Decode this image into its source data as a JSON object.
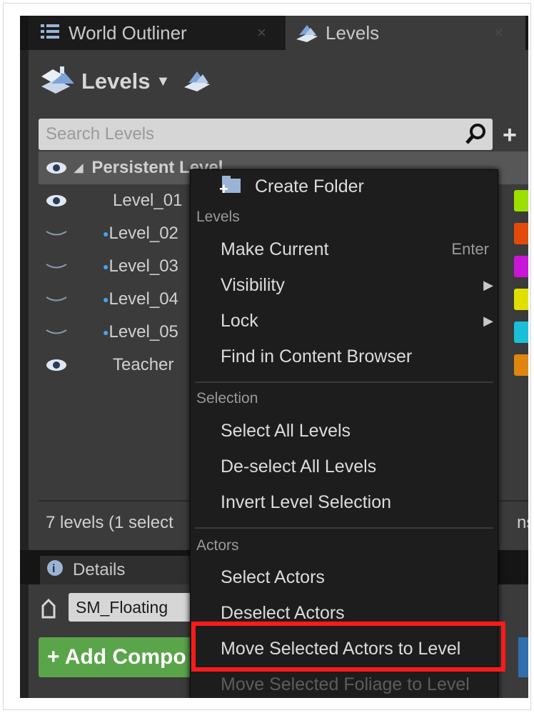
{
  "tabs": [
    {
      "label": "World Outliner",
      "close": "×"
    },
    {
      "label": "Levels",
      "close": "×"
    }
  ],
  "levels_panel": {
    "title": "Levels",
    "search_placeholder": "Search Levels",
    "rows": [
      {
        "name": "Persistent Level",
        "visible": true
      },
      {
        "name": "Level_01",
        "visible": true,
        "color": "#9be000"
      },
      {
        "name": "Level_02",
        "visible": false,
        "color": "#e24b0b"
      },
      {
        "name": "Level_03",
        "visible": false,
        "color": "#c816d8"
      },
      {
        "name": "Level_04",
        "visible": false,
        "color": "#dfe000"
      },
      {
        "name": "Level_05",
        "visible": false,
        "color": "#1ac0d8"
      },
      {
        "name": "Teacher",
        "visible": true,
        "color": "#e0850e"
      }
    ],
    "status": "7 levels (1 select",
    "view_options": "ns"
  },
  "details": {
    "tab_label": "Details",
    "object_name": "SM_Floating",
    "add_component": "+ Add Compo"
  },
  "context_menu": {
    "create_folder": "Create Folder",
    "section_levels": "Levels",
    "make_current": "Make Current",
    "make_current_hint": "Enter",
    "visibility": "Visibility",
    "lock": "Lock",
    "find_in_cb": "Find in Content Browser",
    "section_selection": "Selection",
    "select_all_levels": "Select All Levels",
    "deselect_all_levels": "De-select All Levels",
    "invert_selection": "Invert Level Selection",
    "section_actors": "Actors",
    "select_actors": "Select Actors",
    "deselect_actors": "Deselect Actors",
    "move_actors": "Move Selected Actors to Level",
    "move_foliage": "Move Selected Foliage to Level"
  },
  "colors": {
    "highlight": "#ff1a1a",
    "add_button": "#5aa54a"
  }
}
